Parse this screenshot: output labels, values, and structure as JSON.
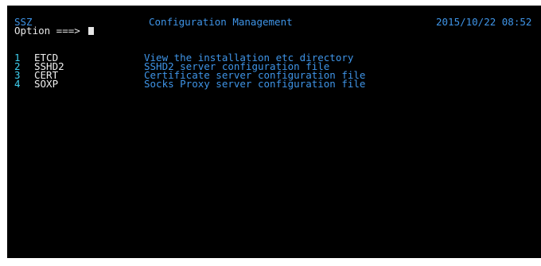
{
  "header": {
    "system_id": "SSZ",
    "title": "Configuration Management",
    "datetime": "2015/10/22 08:52"
  },
  "command": {
    "label": "Option ===>",
    "value": ""
  },
  "menu": [
    {
      "num": "1",
      "code": "ETCD",
      "desc": "View the installation etc directory"
    },
    {
      "num": "2",
      "code": "SSHD2",
      "desc": "SSHD2 server configuration file"
    },
    {
      "num": "3",
      "code": "CERT",
      "desc": "Certificate server configuration file"
    },
    {
      "num": "4",
      "code": "SOXP",
      "desc": "Socks Proxy server configuration file"
    }
  ]
}
